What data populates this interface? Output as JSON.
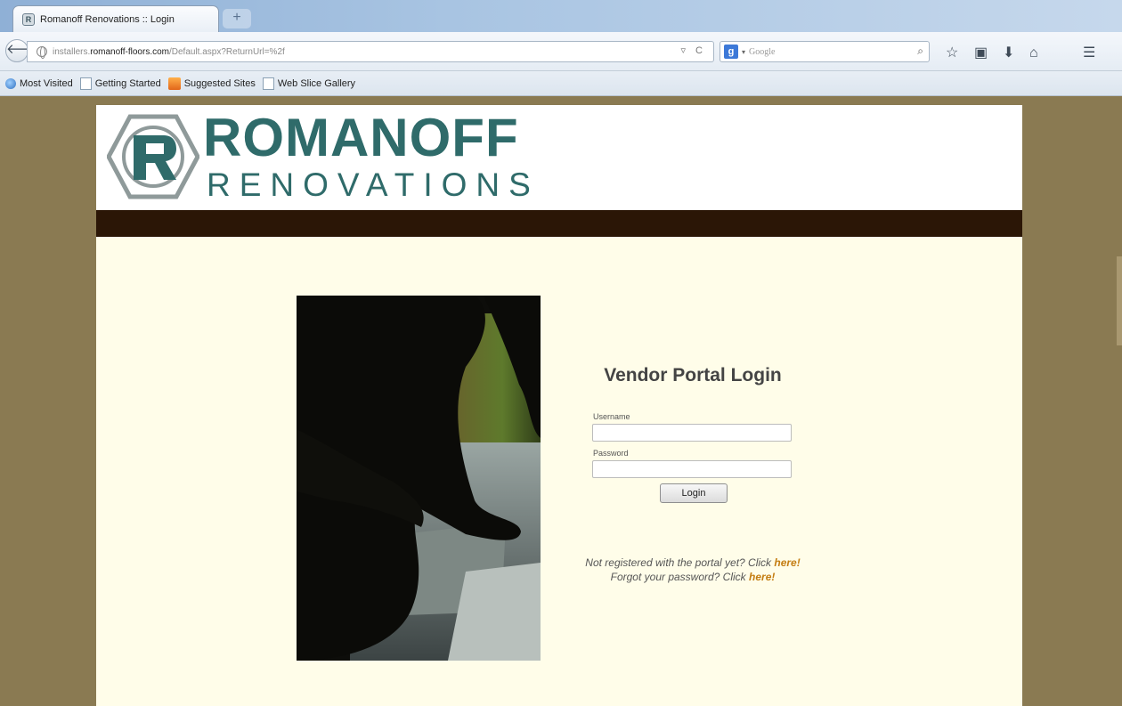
{
  "browser": {
    "tab_title": "Romanoff Renovations :: Login",
    "tab_favicon": "R",
    "new_tab_label": "+",
    "url_prefix": "installers.",
    "url_domain": "romanoff-floors.com",
    "url_path": "/Default.aspx?ReturnUrl=%2f",
    "url_tools": "▿ C",
    "search_engine_icon": "g",
    "search_placeholder": "Google",
    "icons": [
      "back-icon",
      "globe-icon",
      "reload-icon",
      "search-icon",
      "star-icon",
      "clipboard-icon",
      "download-icon",
      "home-icon",
      "menu-icon"
    ]
  },
  "bookmarks": [
    {
      "label": "Most Visited",
      "icon": "bm-icon-blue"
    },
    {
      "label": "Getting Started",
      "icon": "bm-icon-page"
    },
    {
      "label": "Suggested Sites",
      "icon": "bm-icon-ie"
    },
    {
      "label": "Web Slice Gallery",
      "icon": "bm-icon-page"
    }
  ],
  "page": {
    "logo_line1": "ROMANOFF",
    "logo_line2": "RENOVATIONS",
    "login_title": "Vendor Portal Login",
    "username_label": "Username",
    "password_label": "Password",
    "username_value": "",
    "password_value": "",
    "login_button": "Login",
    "register_text": "Not registered with the portal yet? Click ",
    "register_link": "here!",
    "forgot_text": "Forgot your password? Click ",
    "forgot_link": "here!"
  },
  "colors": {
    "brand_teal": "#2f6b6a",
    "header_bar": "#2b1606",
    "page_bg": "#fffde9",
    "outer_bg": "#8a7a52",
    "link": "#c47d12"
  }
}
